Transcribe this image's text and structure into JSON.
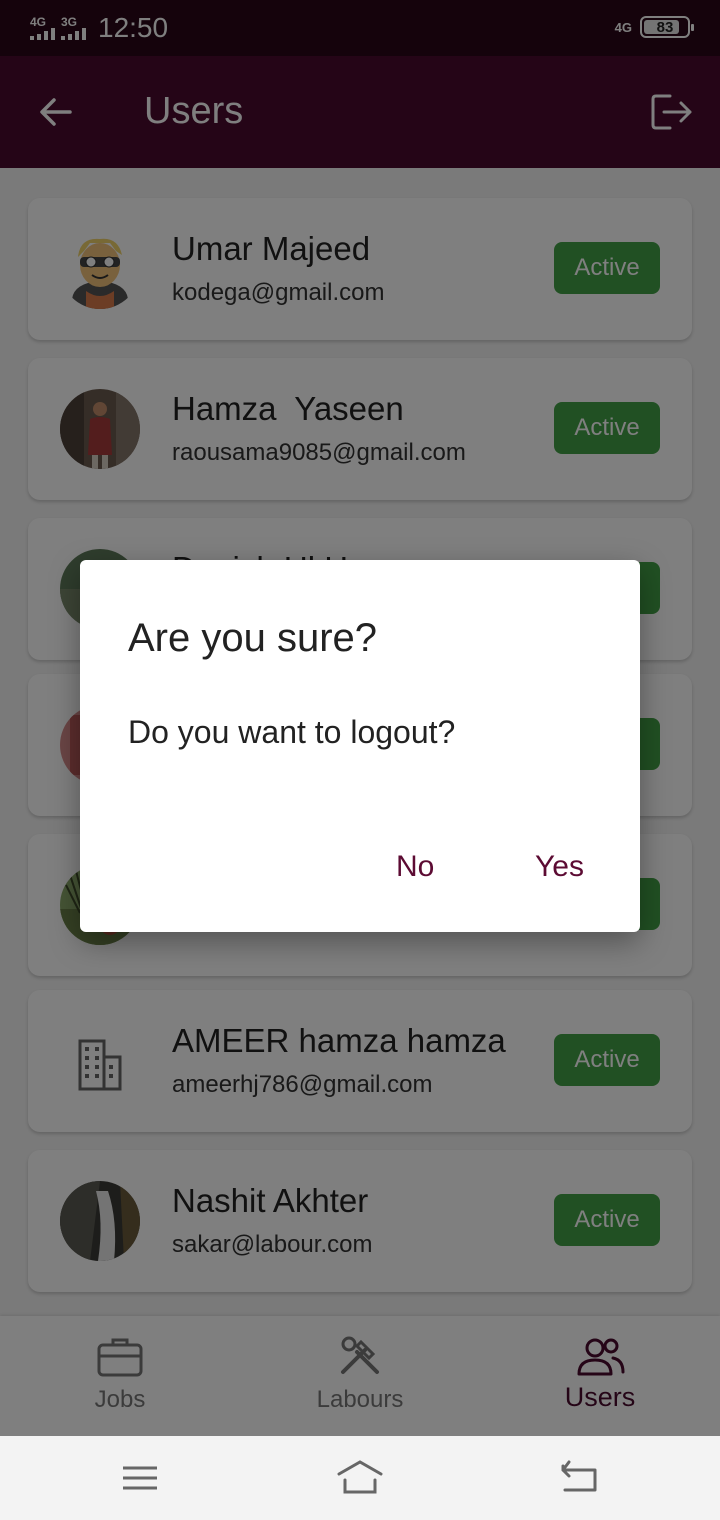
{
  "status_bar": {
    "network1": "4G",
    "network2": "3G",
    "time": "12:50",
    "network3": "4G",
    "battery": "83",
    "battery_level": 0.83
  },
  "app_bar": {
    "title": "Users",
    "back_icon": "arrow-left-icon",
    "logout_icon": "logout-icon"
  },
  "users": [
    {
      "name": "Umar Majeed",
      "email": "kodega@gmail.com",
      "status": "Active"
    },
    {
      "name": "Hamza  Yaseen",
      "email": "raousama9085@gmail.com",
      "status": "Active"
    },
    {
      "name": "Danish Ul Hassan",
      "email": "",
      "status": ""
    },
    {
      "name": "",
      "email": "",
      "status": ""
    },
    {
      "name": "",
      "email": "",
      "status": ""
    },
    {
      "name": "AMEER hamza hamza",
      "email": "ameerhj786@gmail.com",
      "status": "Active"
    },
    {
      "name": "Nashit Akhter",
      "email": "sakar@labour.com",
      "status": "Active"
    }
  ],
  "bottom_nav": [
    {
      "label": "Jobs",
      "icon": "briefcase-icon"
    },
    {
      "label": "Labours",
      "icon": "tools-icon"
    },
    {
      "label": "Users",
      "icon": "users-icon"
    }
  ],
  "dialog": {
    "title": "Are you sure?",
    "message": "Do you want to logout?",
    "no_label": "No",
    "yes_label": "Yes"
  },
  "colors": {
    "primary": "#4a0a2e",
    "status_bar": "#2a0718",
    "active_badge": "#43a047",
    "dialog_button": "#5c0b33"
  }
}
